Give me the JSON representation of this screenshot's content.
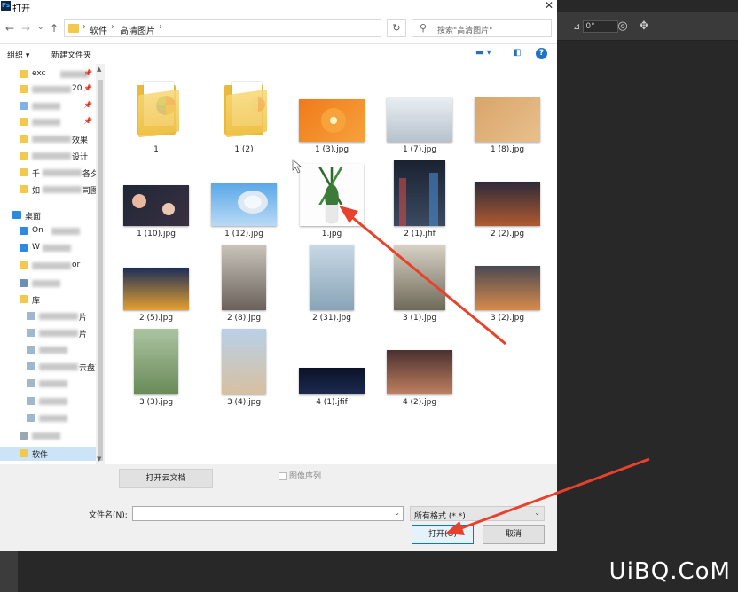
{
  "window": {
    "title": "打开"
  },
  "nav": {
    "back": "←",
    "forward": "→",
    "dropdown": "⌄",
    "up": "↑"
  },
  "address": {
    "crumbs": [
      "软件",
      "高清图片"
    ],
    "sep": "›"
  },
  "search": {
    "placeholder": "搜索\"高清图片\""
  },
  "toolbar": {
    "organize": "组织 ▾",
    "new_folder": "新建文件夹"
  },
  "sidebar": {
    "items": [
      {
        "label": "exc",
        "type": "folder",
        "pinned": true
      },
      {
        "label": "",
        "type": "folder",
        "suffix": "20",
        "pinned": true
      },
      {
        "label": "",
        "type": "folder-blue",
        "pinned": true
      },
      {
        "label": "",
        "type": "folder",
        "pinned": true
      },
      {
        "label": "",
        "type": "folder",
        "suffix": "效果"
      },
      {
        "label": "",
        "type": "folder",
        "suffix": "设计"
      },
      {
        "label": "千",
        "type": "folder",
        "suffix": "各夕"
      },
      {
        "label": "如",
        "type": "folder",
        "suffix": "司图"
      },
      {
        "label": "桌面",
        "type": "desktop"
      },
      {
        "label": "On",
        "type": "cloud"
      },
      {
        "label": "W",
        "type": "cloud"
      },
      {
        "label": "",
        "type": "folder",
        "suffix": "or"
      },
      {
        "label": "",
        "type": "pc"
      },
      {
        "label": "库",
        "type": "lib"
      },
      {
        "label": "",
        "type": "lib-item",
        "suffix": "片"
      },
      {
        "label": "",
        "type": "lib-item",
        "suffix": "片"
      },
      {
        "label": "",
        "type": "lib-item"
      },
      {
        "label": "",
        "type": "lib-item",
        "suffix": "云盘下载"
      },
      {
        "label": "",
        "type": "lib-item"
      },
      {
        "label": "",
        "type": "lib-item"
      },
      {
        "label": "",
        "type": "lib-item"
      },
      {
        "label": "",
        "type": "drive"
      },
      {
        "label": "软件",
        "type": "folder",
        "selected": true
      }
    ]
  },
  "files": [
    {
      "name": "1",
      "kind": "folder"
    },
    {
      "name": "1 (2)",
      "kind": "folder"
    },
    {
      "name": "1 (3).jpg",
      "kind": "image"
    },
    {
      "name": "1 (7).jpg",
      "kind": "image"
    },
    {
      "name": "1 (8).jpg",
      "kind": "image"
    },
    {
      "name": "1 (10).jpg",
      "kind": "image"
    },
    {
      "name": "1 (12).jpg",
      "kind": "image"
    },
    {
      "name": "1.jpg",
      "kind": "image"
    },
    {
      "name": "2 (1).jfif",
      "kind": "image"
    },
    {
      "name": "2 (2).jpg",
      "kind": "image"
    },
    {
      "name": "2 (5).jpg",
      "kind": "image"
    },
    {
      "name": "2 (8).jpg",
      "kind": "image"
    },
    {
      "name": "2 (31).jpg",
      "kind": "image"
    },
    {
      "name": "3 (1).jpg",
      "kind": "image"
    },
    {
      "name": "3 (2).jpg",
      "kind": "image"
    },
    {
      "name": "3 (3).jpg",
      "kind": "image"
    },
    {
      "name": "3 (4).jpg",
      "kind": "image"
    },
    {
      "name": "4 (1).jfif",
      "kind": "image"
    },
    {
      "name": "4 (2).jpg",
      "kind": "image"
    }
  ],
  "bottom": {
    "cloud_button": "打开云文档",
    "image_sequence": "图像序列",
    "filename_label": "文件名(N):",
    "filename_value": "",
    "filetype": "所有格式 (*.*)",
    "open": "打开(O)",
    "cancel": "取消"
  },
  "ps": {
    "angle": "0°"
  },
  "watermark": "UiBQ.CoM",
  "colors": {
    "accent": "#0078d7",
    "selection": "#cce4f7",
    "annotation_arrow": "#e8412c"
  }
}
